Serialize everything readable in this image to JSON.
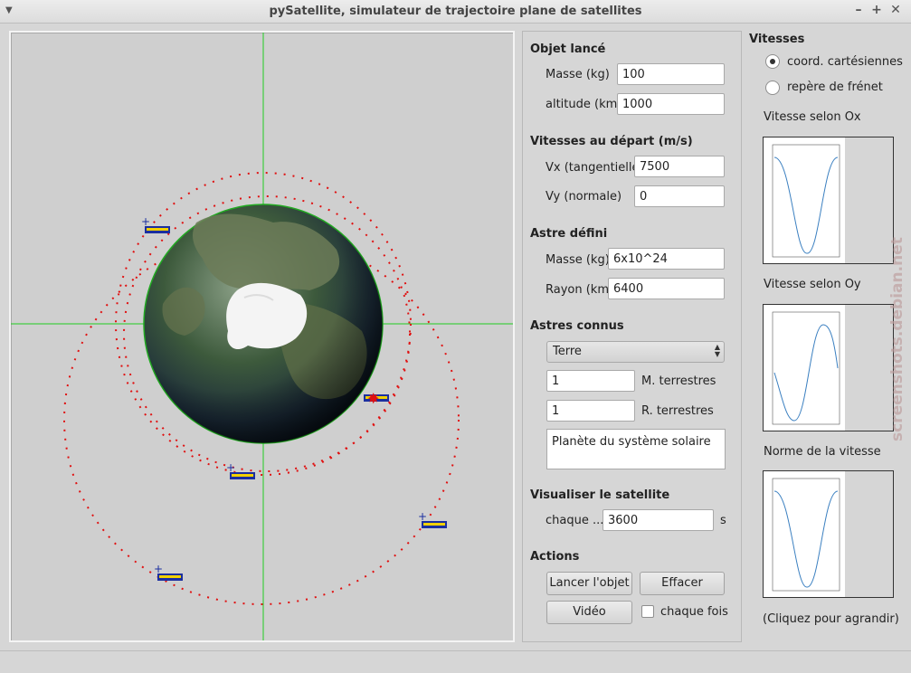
{
  "window": {
    "title": "pySatellite, simulateur de trajectoire plane de satellites",
    "buttons": [
      "–",
      "+",
      "✕"
    ]
  },
  "objet": {
    "title": "Objet lancé",
    "masse_label": "Masse (kg)",
    "masse_value": "100",
    "altitude_label": "altitude (km)",
    "altitude_value": "1000"
  },
  "vitesses_depart": {
    "title": "Vitesses au départ (m/s)",
    "vx_label": "Vx (tangentielle)",
    "vx_value": "7500",
    "vy_label": "Vy (normale)",
    "vy_value": "0"
  },
  "astre": {
    "title": "Astre défini",
    "masse_label": "Masse (kg)",
    "masse_value": "6x10^24",
    "rayon_label": "Rayon (km)",
    "rayon_value": "6400"
  },
  "astres_connus": {
    "title": "Astres connus",
    "selected": "Terre",
    "m_value": "1",
    "m_label": "M. terrestres",
    "r_value": "1",
    "r_label": "R. terrestres",
    "description": "Planète du système solaire"
  },
  "visualiser": {
    "title": "Visualiser le satellite",
    "label": "chaque ...",
    "value": "3600",
    "unit": "s"
  },
  "actions": {
    "title": "Actions",
    "lancer": "Lancer l'objet",
    "effacer": "Effacer",
    "video": "Vidéo",
    "chaque_fois": "chaque fois"
  },
  "vitesses": {
    "title": "Vitesses",
    "opt1": "coord. cartésiennes",
    "opt2": "repère de frénet",
    "selected_option": "coord. cartésiennes",
    "plot1_label": "Vitesse selon Ox",
    "plot2_label": "Vitesse selon Oy",
    "plot3_label": "Norme de la vitesse",
    "hint": "(Cliquez pour agrandir)"
  },
  "watermark": "screenshots.debian.net",
  "colors": {
    "trajectory": "#e01010",
    "axes": "#22cc22",
    "plot_line": "#3a7fc0"
  }
}
